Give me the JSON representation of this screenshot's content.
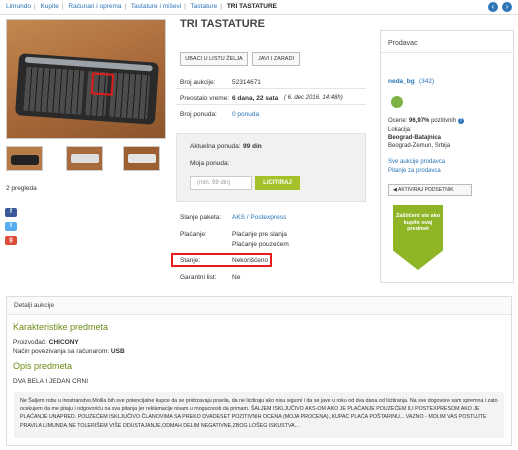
{
  "breadcrumb": [
    "Limundo",
    "Kupite",
    "Računari i oprema",
    "Tastature i miševi",
    "Tastature",
    "TRI TASTATURE"
  ],
  "nav": {
    "prev_icon": "chevron-left-icon",
    "next_icon": "chevron-right-icon"
  },
  "gallery": {
    "views": "2 pregleda"
  },
  "title": "TRI TASTATURE",
  "buttons": {
    "wishlist": "UBACI U LISTU ŽELJA",
    "follow": "JAVI I ZARADI"
  },
  "info": {
    "auction_label": "Broj aukcije:",
    "auction_value": "52314671",
    "time_label": "Preostalo vreme:",
    "time_value": "6 dana, 22 sata",
    "time_date": "( 6. dec 2016. 14:48h)",
    "bids_label": "Broj ponuda:",
    "bids_value": "0 ponuda"
  },
  "bid": {
    "current_label": "Aktuelna ponuda:",
    "current_value": "99 din",
    "my_label": "Moja ponuda:",
    "placeholder": "(min. 99 din)",
    "button": "LICITIRAJ"
  },
  "shipping": {
    "ship_label": "Slanje paketa:",
    "ship_value": "AKS / Postexpress",
    "pay_label": "Plaćanje:",
    "pay_value1": "Plaćanje pre slanja",
    "pay_value2": "Plaćanje pouzećem",
    "state_label": "Stanje:",
    "state_value": "Nekorišćeno",
    "warranty_label": "Garantni list:",
    "warranty_value": "Ne"
  },
  "seller": {
    "heading": "Prodavac",
    "name": "neda_bg",
    "count": "(342)",
    "rating_label": "Ocene:",
    "rating_value": "96,97%",
    "rating_suffix": "pozitivnih",
    "location_label": "Lokacija:",
    "location_city": "Beograd-Batajnica",
    "location_detail": "Beograd-Zemun, Srbija",
    "all_link": "Sve aukcije prodavca",
    "ask_link": "Pitanje za prodavca",
    "watch_button": "AKTIVIRAJ PODSETNIK",
    "protect_text": "Zaštićeni ste ako kupite ovaj predmet"
  },
  "details": {
    "heading": "Detalji aukcije",
    "char_heading": "Karakteristike predmeta",
    "maker_label": "Proizvođač:",
    "maker_value": "CHICONY",
    "conn_label": "Način povezivanja sa računarom:",
    "conn_value": "USB",
    "desc_heading": "Opis predmeta",
    "desc_text": "DVA BELA I JEDAN CRNI",
    "notice": "Ne Šaljem robu u inostranstvo.Molila bih sve potencijalne kupce da se pridrzavaju pravila, da ne licitiraju ako nisu sigurni i da se javе u roku od dva dana od licitiranja. Na sve dogovore sam spremna i zato ocekujem da me pitaju i odgovoriću na sva pitanja jer reklamacije nisam u mogucnosti da primam. ŠALJEM ISKLJUČIVO AKS-OM AKO JE PLAĆANJE POUZEĆEM ILI POSTEXPRESOM AKO JE PLAĆANJE UNAPRED. POUZEĆEM ISKLJUČIVO ČLANOVIMA SA PREKO DVADESET POZITIVNIH OCENA (MOJA PROCENA).,KUPAC PLAĆA POŠTARINU... VAZNO - MOLIM VAS POSTUJTE PRAVILA LIMUNDA.NE TOLERIŠEM VIŠE ODUSTAJANJE,ODMAH DELIM NEGATIVNE,ZBOG LOŠEG ISKUSTVA..."
  },
  "colors": {
    "accent": "#2a74b7",
    "green": "#a5c22a",
    "highlight": "#e01c1c"
  }
}
